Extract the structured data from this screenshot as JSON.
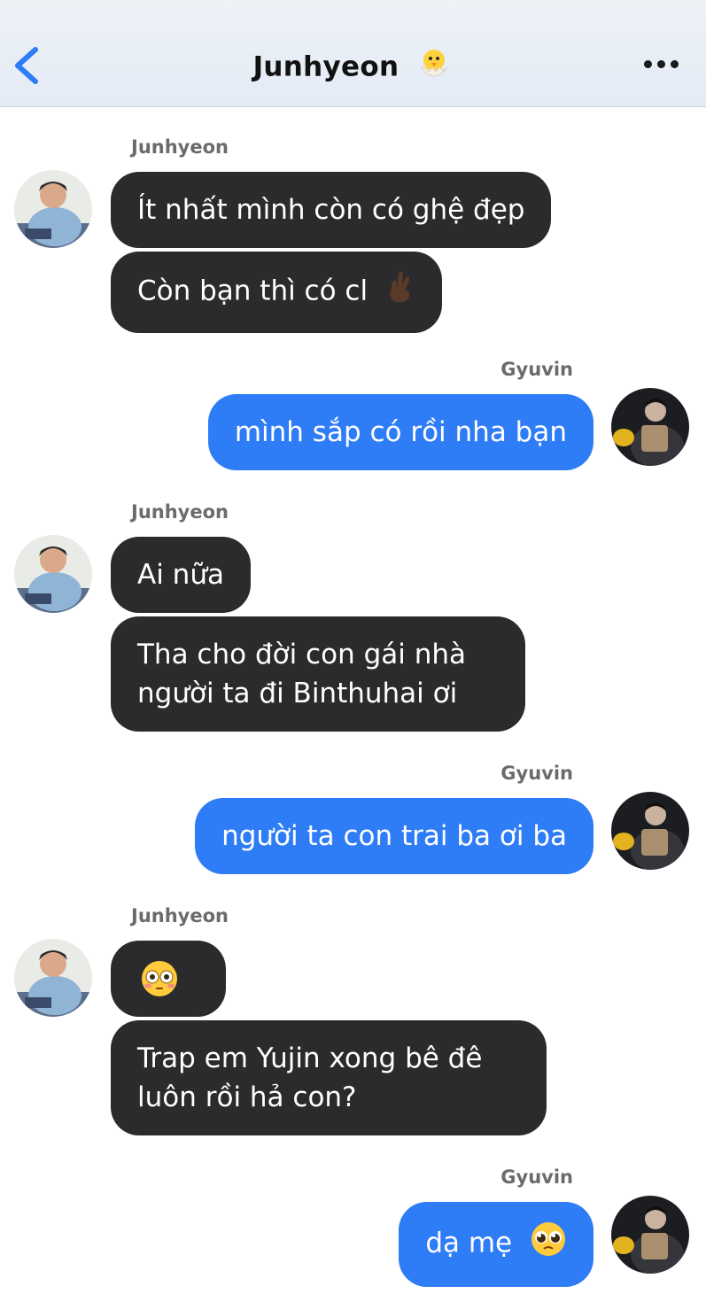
{
  "header": {
    "title": "Junhyeon",
    "back_icon": "chevron-left-icon",
    "title_emoji": "hatching-chick-icon",
    "more_icon": "more-horizontal-icon"
  },
  "colors": {
    "incoming_bubble": "#2b2b2d",
    "outgoing_bubble": "#2e7cf6",
    "back_accent": "#2e7cf6"
  },
  "messages": [
    {
      "sender": "Junhyeon",
      "side": "left",
      "texts": [
        "Ít nhất mình còn có ghệ đẹp",
        "Còn bạn thì có cl"
      ]
    },
    {
      "sender": "Gyuvin",
      "side": "right",
      "texts": [
        "mình sắp có rồi nha bạn"
      ]
    },
    {
      "sender": "Junhyeon",
      "side": "left",
      "texts": [
        "Ai nữa",
        "Tha cho đời con gái nhà người ta đi Binthuhai ơi"
      ]
    },
    {
      "sender": "Gyuvin",
      "side": "right",
      "texts": [
        "người ta con trai ba ơi ba"
      ]
    },
    {
      "sender": "Junhyeon",
      "side": "left",
      "texts": [
        "",
        "Trap em Yujin xong bê đê luôn rồi hả con?"
      ]
    },
    {
      "sender": "Gyuvin",
      "side": "right",
      "texts": [
        "dạ mẹ"
      ]
    }
  ],
  "emojis": {
    "fingers_crossed": "fingers-crossed-icon",
    "flushed": "flushed-face-icon",
    "pleading": "pleading-face-icon"
  }
}
